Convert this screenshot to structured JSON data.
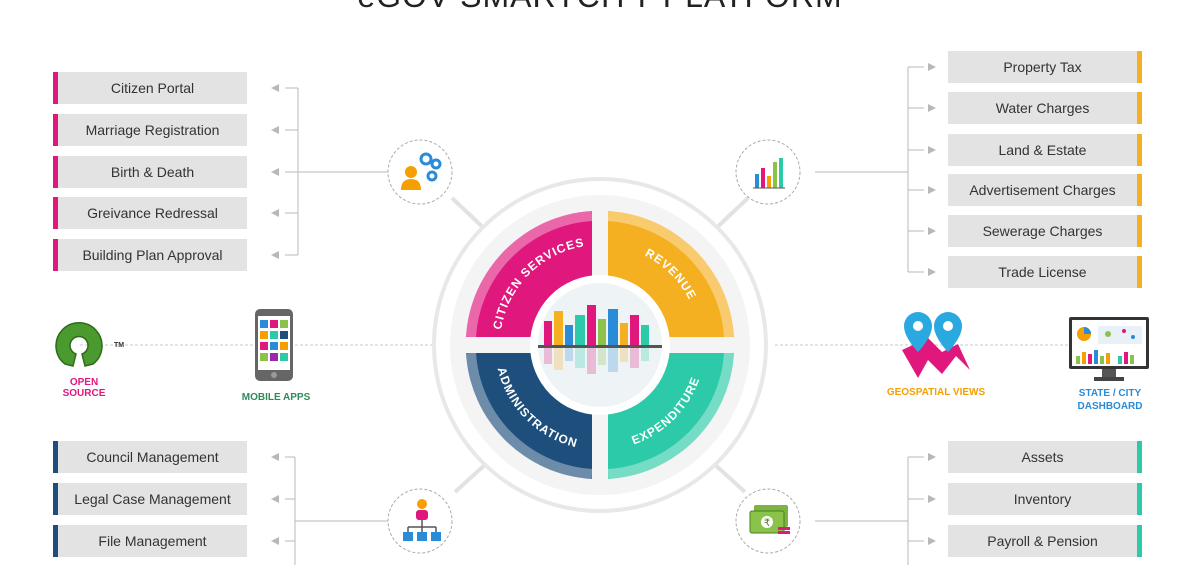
{
  "title": "eGOV SMARTCITY PLATFORM",
  "citizen_services": [
    "Citizen Portal",
    "Marriage Registration",
    "Birth & Death",
    "Greivance Redressal",
    "Building Plan Approval"
  ],
  "revenue": [
    "Property Tax",
    "Water Charges",
    "Land & Estate",
    "Advertisement Charges",
    "Sewerage Charges",
    "Trade License"
  ],
  "administration": [
    "Council Management",
    "Legal Case Management",
    "File Management"
  ],
  "expenditure": [
    "Assets",
    "Inventory",
    "Payroll & Pension"
  ],
  "wheel": {
    "citizen_services": "CITIZEN SERVICES",
    "revenue": "REVENUE",
    "administration": "ADMINISTRATION",
    "expenditure": "EXPENDITURE"
  },
  "side_labels": {
    "open_source": "OPEN SOURCE",
    "tm": "TM",
    "mobile_apps": "MOBILE APPS",
    "geospatial": "GEOSPATIAL VIEWS",
    "dashboard_line1": "STATE / CITY",
    "dashboard_line2": "DASHBOARD"
  },
  "colors": {
    "citizen_services": "#e0177d",
    "revenue": "#f5b021",
    "administration": "#1e4f7c",
    "expenditure": "#2ccaa8"
  },
  "icons": [
    "user-gears-icon",
    "bar-chart-icon",
    "org-chart-icon",
    "currency-notes-icon",
    "open-source-logo",
    "mobile-phone-icon",
    "map-pins-icon",
    "dashboard-monitor-icon",
    "city-skyline-icon"
  ]
}
